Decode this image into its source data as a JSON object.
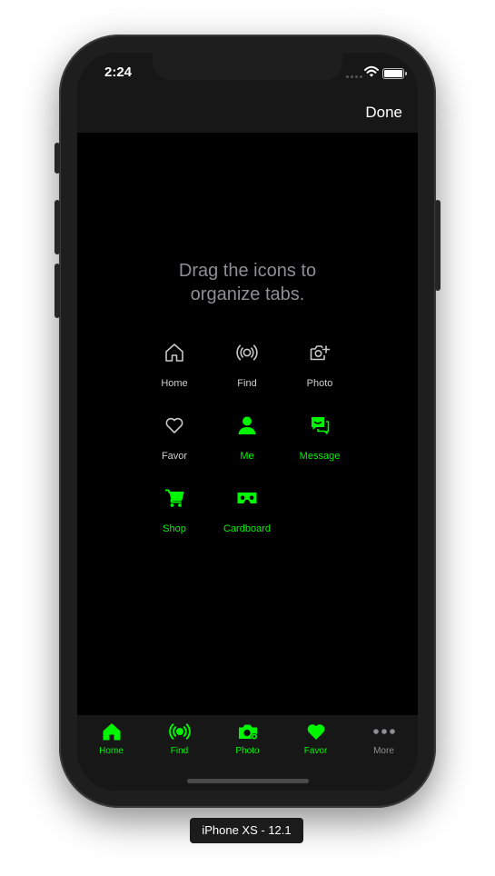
{
  "status_bar": {
    "time": "2:24"
  },
  "nav": {
    "done_label": "Done"
  },
  "instruction": {
    "line1": "Drag the icons to",
    "line2": "organize tabs."
  },
  "grid": [
    {
      "label": "Home",
      "icon": "home-icon",
      "active": false
    },
    {
      "label": "Find",
      "icon": "broadcast-icon",
      "active": false
    },
    {
      "label": "Photo",
      "icon": "camera-icon",
      "active": false
    },
    {
      "label": "Favor",
      "icon": "heart-icon",
      "active": false
    },
    {
      "label": "Me",
      "icon": "person-icon",
      "active": true
    },
    {
      "label": "Message",
      "icon": "message-icon",
      "active": true
    },
    {
      "label": "Shop",
      "icon": "cart-icon",
      "active": true
    },
    {
      "label": "Cardboard",
      "icon": "cardboard-icon",
      "active": true
    }
  ],
  "tabbar": [
    {
      "label": "Home",
      "icon": "home-icon"
    },
    {
      "label": "Find",
      "icon": "broadcast-icon"
    },
    {
      "label": "Photo",
      "icon": "camera-icon"
    },
    {
      "label": "Favor",
      "icon": "heart-icon"
    },
    {
      "label": "More",
      "icon": "more-icon"
    }
  ],
  "device_caption": "iPhone XS - 12.1",
  "colors": {
    "accent": "#00f500",
    "inactive_icon": "#c8c8c8",
    "more_gray": "#8e8e93",
    "background": "#000000",
    "bar": "#171717"
  }
}
